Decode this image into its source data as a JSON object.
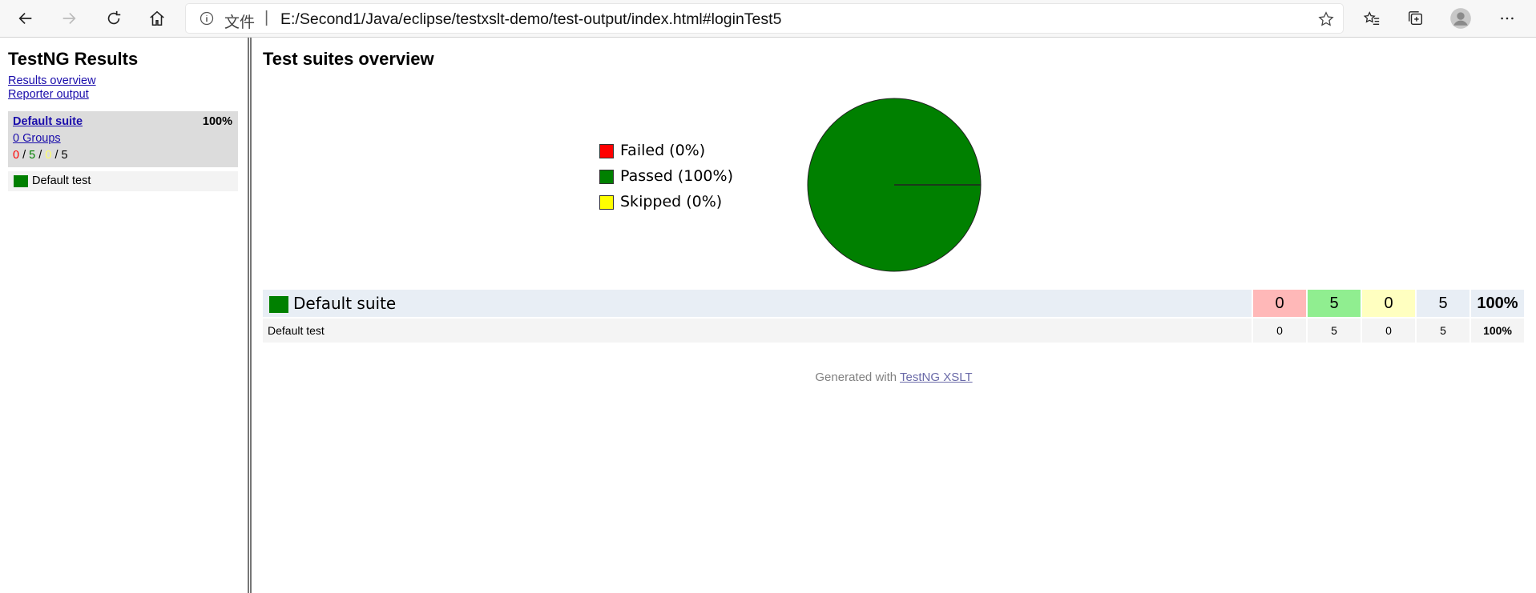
{
  "browser": {
    "scheme_label": "文件",
    "separator": "|",
    "url": "E:/Second1/Java/eclipse/testxslt-demo/test-output/index.html#loginTest5",
    "icons": [
      "back-icon",
      "forward-icon",
      "refresh-icon",
      "home-icon",
      "info-icon",
      "star-icon",
      "favorites-icon",
      "collections-icon",
      "profile-icon",
      "more-icon"
    ]
  },
  "nav": {
    "title": "TestNG Results",
    "links": [
      "Results overview",
      "Reporter output"
    ],
    "suite": {
      "name": "Default suite",
      "percent": "100%",
      "groups": "0 Groups",
      "failed": "0",
      "passed": "5",
      "skipped": "0",
      "total": "5",
      "sep": " / "
    },
    "tests": [
      {
        "name": "Default test"
      }
    ]
  },
  "main": {
    "title": "Test suites overview",
    "legend": [
      {
        "label": "Failed (0%)",
        "color": "#ff0000"
      },
      {
        "label": "Passed (100%)",
        "color": "#008000"
      },
      {
        "label": "Skipped (0%)",
        "color": "#ffff00"
      }
    ],
    "summary": {
      "suite_row": {
        "name": "Default suite",
        "failed": "0",
        "passed": "5",
        "skipped": "0",
        "total": "5",
        "percent": "100%"
      },
      "test_row": {
        "name": "Default test",
        "failed": "0",
        "passed": "5",
        "skipped": "0",
        "total": "5",
        "percent": "100%"
      }
    },
    "footer": {
      "prefix": "Generated with ",
      "link": "TestNG XSLT"
    }
  },
  "chart_data": {
    "type": "pie",
    "categories": [
      "Failed",
      "Passed",
      "Skipped"
    ],
    "values": [
      0,
      100,
      0
    ],
    "colors": [
      "#ff0000",
      "#008000",
      "#ffff00"
    ],
    "legend_placement": "left"
  }
}
